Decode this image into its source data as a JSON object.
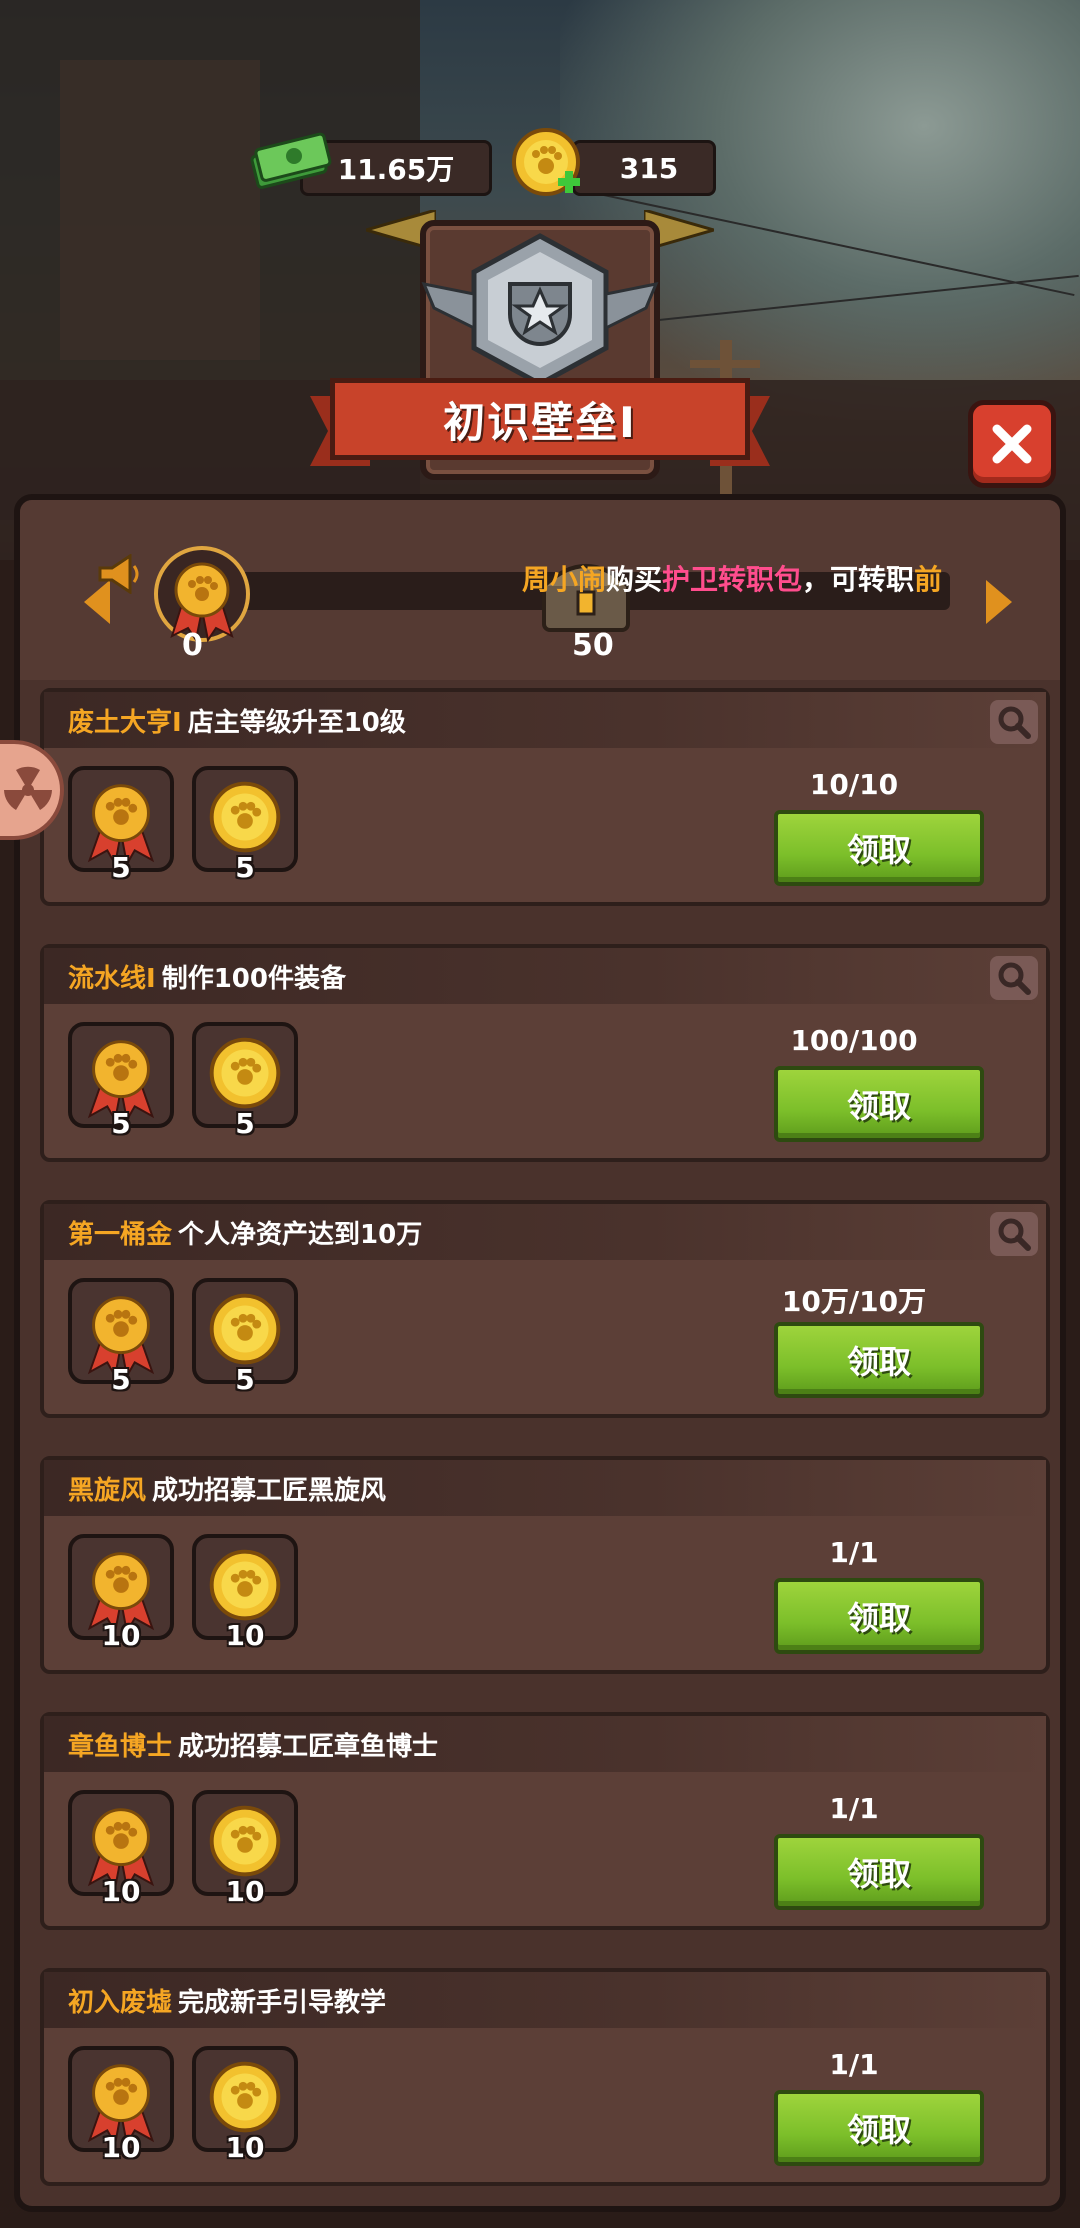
{
  "currency": {
    "cash": "11.65万",
    "gold": "315"
  },
  "header": {
    "title": "初识壁垒I"
  },
  "progress": {
    "start_value": "0",
    "milestone_value": "50",
    "ticker": {
      "name": "周小闹",
      "text_a": "购买",
      "highlight": "护卫转职包",
      "text_b": "，可转职",
      "tail": "前擀"
    }
  },
  "achievements": [
    {
      "name": "废土大亨I",
      "desc": "店主等级升至10级",
      "progress": "10/10",
      "reward_badge": "5",
      "reward_gold": "5",
      "button": "领取",
      "has_search": true
    },
    {
      "name": "流水线I",
      "desc": "制作100件装备",
      "progress": "100/100",
      "reward_badge": "5",
      "reward_gold": "5",
      "button": "领取",
      "has_search": true
    },
    {
      "name": "第一桶金",
      "desc": "个人净资产达到10万",
      "progress": "10万/10万",
      "reward_badge": "5",
      "reward_gold": "5",
      "button": "领取",
      "has_search": true
    },
    {
      "name": "黑旋风",
      "desc": "成功招募工匠黑旋风",
      "progress": "1/1",
      "reward_badge": "10",
      "reward_gold": "10",
      "button": "领取",
      "has_search": false
    },
    {
      "name": "章鱼博士",
      "desc": "成功招募工匠章鱼博士",
      "progress": "1/1",
      "reward_badge": "10",
      "reward_gold": "10",
      "button": "领取",
      "has_search": false
    },
    {
      "name": "初入废墟",
      "desc": "完成新手引导教学",
      "progress": "1/1",
      "reward_badge": "10",
      "reward_gold": "10",
      "button": "领取",
      "has_search": false
    }
  ],
  "colors": {
    "accent_gold": "#f5a623",
    "claim_green": "#7cbf2a",
    "ticker_pink": "#ff4d8d",
    "panel_brown": "#4a322c"
  }
}
